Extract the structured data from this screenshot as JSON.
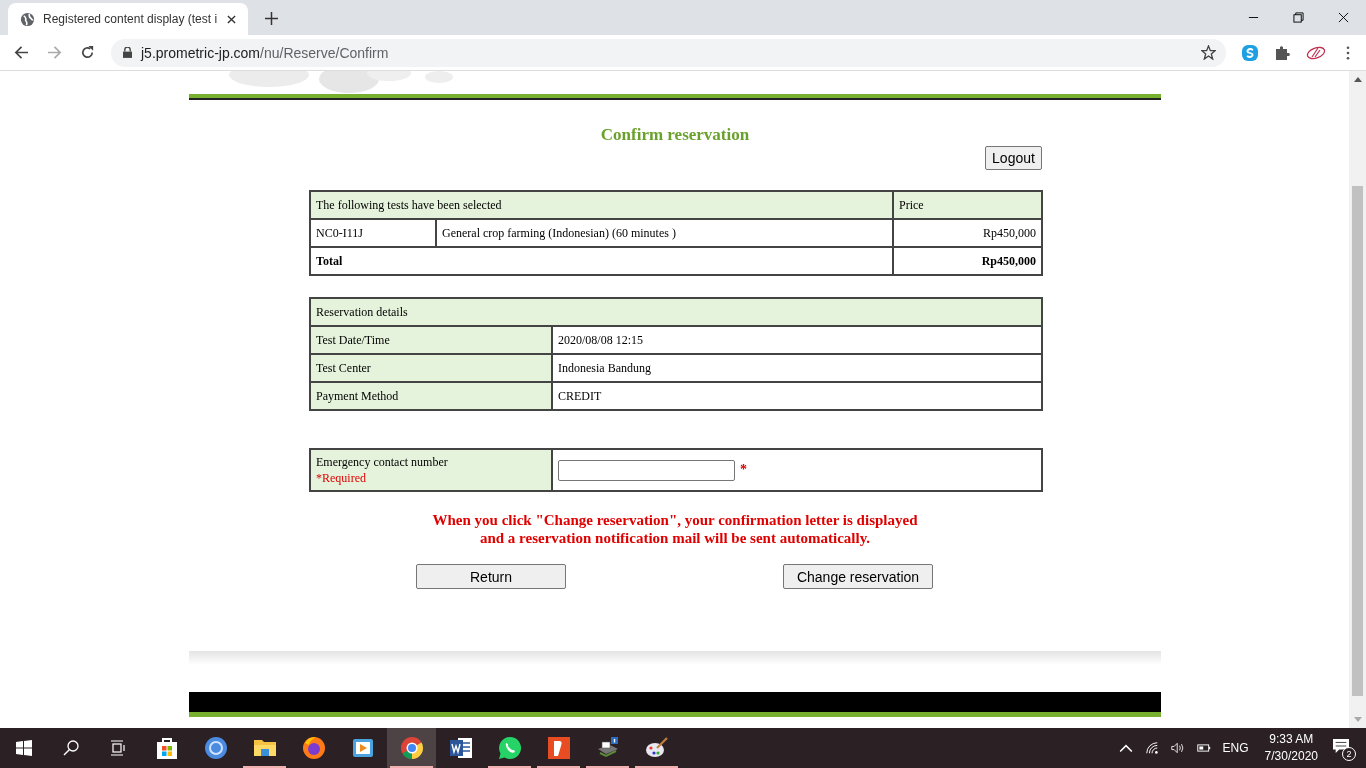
{
  "browser": {
    "tab_title": "Registered content display (test i",
    "url_host": "j5.prometric-jp.com",
    "url_path": "/nu/Reserve/Confirm"
  },
  "page": {
    "title": "Confirm reservation",
    "logout": "Logout",
    "tests": {
      "header": "The following tests have been selected",
      "price_header": "Price",
      "rows": [
        {
          "code": "NC0-I11J",
          "name": "General crop farming (Indonesian)  (60 minutes )",
          "price": "Rp450,000"
        }
      ],
      "total_label": "Total",
      "total_amount": "Rp450,000"
    },
    "details": {
      "header": "Reservation details",
      "rows": [
        {
          "label": "Test Date/Time",
          "value": "2020/08/08  12:15"
        },
        {
          "label": "Test Center",
          "value": "Indonesia Bandung"
        },
        {
          "label": "Payment Method",
          "value": "CREDIT"
        }
      ]
    },
    "emergency": {
      "label": "Emergency contact number",
      "note": "*Required",
      "mark": "*"
    },
    "notice": [
      "When you click \"Change reservation\", your confirmation letter is displayed",
      "and a reservation notification mail will be sent automatically."
    ],
    "buttons": [
      "Return",
      "Change reservation"
    ]
  },
  "taskbar": {
    "apps": [
      {
        "kind": "store",
        "running": false,
        "selected": false
      },
      {
        "kind": "circle",
        "running": false,
        "selected": false
      },
      {
        "kind": "folder",
        "running": true,
        "selected": false
      },
      {
        "kind": "firefox",
        "running": false,
        "selected": false
      },
      {
        "kind": "player",
        "running": false,
        "selected": false
      },
      {
        "kind": "chrome",
        "running": true,
        "selected": true
      },
      {
        "kind": "word",
        "running": false,
        "selected": false
      },
      {
        "kind": "whatsapp",
        "running": true,
        "selected": false
      },
      {
        "kind": "pdf",
        "running": true,
        "selected": false
      },
      {
        "kind": "printer",
        "running": true,
        "selected": false
      },
      {
        "kind": "paint",
        "running": true,
        "selected": false
      }
    ],
    "language": "ENG",
    "time": "9:33 AM",
    "date": "7/30/2020",
    "notifications": "2"
  }
}
